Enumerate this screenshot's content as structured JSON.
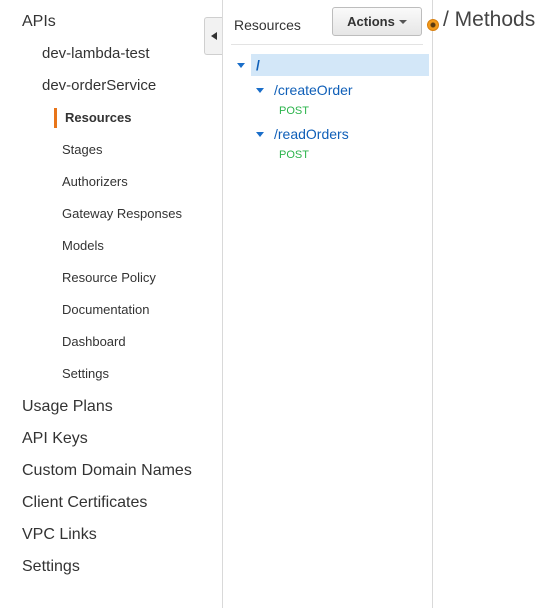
{
  "nav": {
    "apis": "APIs",
    "api_list": [
      "dev-lambda-test",
      "dev-orderService"
    ],
    "sub_items": [
      "Resources",
      "Stages",
      "Authorizers",
      "Gateway Responses",
      "Models",
      "Resource Policy",
      "Documentation",
      "Dashboard",
      "Settings"
    ],
    "bottom": [
      "Usage Plans",
      "API Keys",
      "Custom Domain Names",
      "Client Certificates",
      "VPC Links",
      "Settings"
    ],
    "active_color": "#e8751a"
  },
  "resources": {
    "title": "Resources",
    "actions_label": "Actions",
    "root": "/",
    "children": [
      {
        "path": "/createOrder",
        "method": "POST"
      },
      {
        "path": "/readOrders",
        "method": "POST"
      }
    ],
    "selected_color": "#d3e7f8",
    "link_color": "#0f5fb8",
    "method_color": "#2bb34b"
  },
  "main": {
    "title": "/ Methods"
  }
}
